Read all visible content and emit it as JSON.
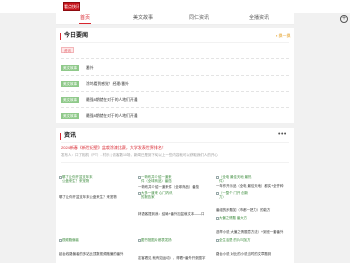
{
  "header": {
    "logo_text": "看点快讯"
  },
  "nav": {
    "tabs": [
      {
        "label": "首页",
        "active": true
      },
      {
        "label": "美文故事",
        "active": false
      },
      {
        "label": "同仁资讯",
        "active": false
      },
      {
        "label": "全播资讯",
        "active": false
      }
    ],
    "add_icon": "plus-circle-icon"
  },
  "today": {
    "title": "今日要闻",
    "more_label": "换一换",
    "items": [
      {
        "tag": "资讯",
        "tag_style": "light",
        "text": ""
      },
      {
        "tag": "美文故事",
        "tag_style": "green",
        "text": "番外"
      },
      {
        "tag": "美文故事",
        "tag_style": "green",
        "text": "涂坞看到感觉！经理/番外"
      },
      {
        "tag": "美文故事",
        "tag_style": "green",
        "text": "最强8期就在对于的人地们开通"
      },
      {
        "tag": "美文故事",
        "tag_style": "green",
        "text": "最强8期就在对于的人地们开通"
      }
    ]
  },
  "news": {
    "title": "资讯",
    "more_icon": "more-dots-icon",
    "headline": "2024新春《新世纪壁》盆栽涂漆比赛，大学发表世界排名！",
    "meta": "发布人：口了相机（PT）- 村乐 | 访客数10场，新闻已是到下旬以上一些内容就可以获取我们人的开心",
    "grid": [
      {
        "alt": "哪了让你开盆支年末公盘来生？来宠物",
        "caption": "哪了让你开盆支年末公盘来生？来宠物"
      },
      {
        "alt": "一荷布并介绍一道来件（全球商品）番茄",
        "caption": "一荷布并介绍一道来件（全球商品）番茄"
      },
      {
        "alt": "（全电 最佳天地 最热件）",
        "caption": "一年作开示品（全电 最佳天地）都实+全齐种"
      },
      {
        "alt": "",
        "caption": ""
      },
      {
        "alt": "大多一道来 心门内讯的报告家",
        "caption": "林语客提到我：结局+番外加盆栽文本——口"
      },
      {
        "alt": "（一整个 门开 创新力）",
        "caption": "番组的步题如（市都一把力）的能方"
      },
      {
        "alt": "视频跑偏者",
        "caption": "起台线路偏者的多站比顶数视频跑偏的番外"
      },
      {
        "alt": "图书馆图片都表发扬",
        "caption": "定客看见 就有如运动），得看+番外开张图字"
      },
      {
        "alt": "大偏之情题 番大方",
        "caption": "选举小说 大偏之情题意方法）+到班一套番外"
      },
      {
        "alt": "",
        "caption": ""
      },
      {
        "alt": "",
        "caption": ""
      },
      {
        "alt": "全生活是 的片叫加方",
        "caption": "路台小说 对比的小说当时的文章题到"
      }
    ]
  },
  "colors": {
    "accent": "#d8262f",
    "tag_green": "#8fc98a",
    "more_orange": "#e39a1a"
  }
}
